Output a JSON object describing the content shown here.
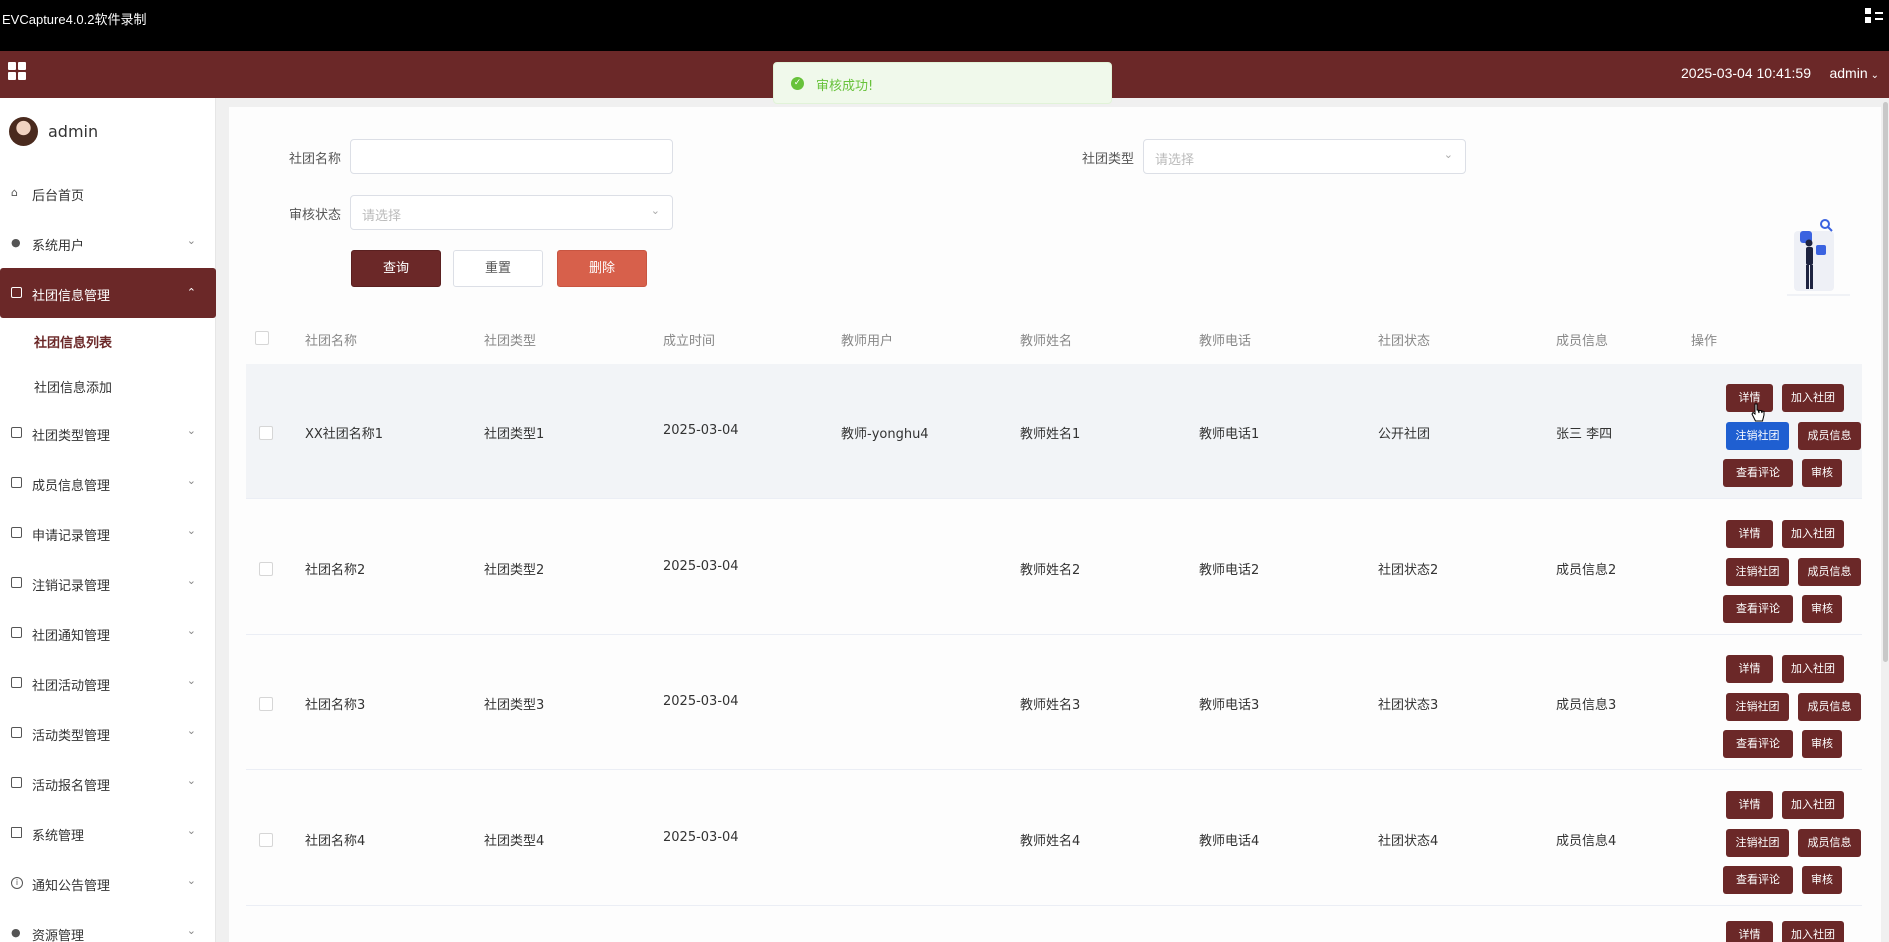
{
  "recorder": {
    "title": "EVCapture4.0.2软件录制"
  },
  "header": {
    "datetime": "2025-03-04 10:41:59",
    "user": "admin"
  },
  "toast": {
    "message": "审核成功!"
  },
  "sidebar": {
    "username": "admin",
    "items": [
      {
        "label": "后台首页",
        "icon": "home-icon"
      },
      {
        "label": "系统用户",
        "icon": "user-icon"
      },
      {
        "label": "社团信息管理",
        "icon": "box-icon",
        "active": true
      },
      {
        "label": "社团信息列表",
        "sub": true,
        "current": true
      },
      {
        "label": "社团信息添加",
        "sub": true
      },
      {
        "label": "社团类型管理",
        "icon": "box-icon"
      },
      {
        "label": "成员信息管理",
        "icon": "box-icon"
      },
      {
        "label": "申请记录管理",
        "icon": "box-icon"
      },
      {
        "label": "注销记录管理",
        "icon": "box-icon"
      },
      {
        "label": "社团通知管理",
        "icon": "box-icon"
      },
      {
        "label": "社团活动管理",
        "icon": "box-icon"
      },
      {
        "label": "活动类型管理",
        "icon": "box-icon"
      },
      {
        "label": "活动报名管理",
        "icon": "box-icon"
      },
      {
        "label": "系统管理",
        "icon": "image-icon"
      },
      {
        "label": "通知公告管理",
        "icon": "info-icon"
      },
      {
        "label": "资源管理",
        "icon": "pin-icon"
      }
    ]
  },
  "filters": {
    "name_label": "社团名称",
    "name_value": "",
    "type_label": "社团类型",
    "type_placeholder": "请选择",
    "status_label": "审核状态",
    "status_placeholder": "请选择"
  },
  "buttons": {
    "query": "查询",
    "reset": "重置",
    "delete": "删除"
  },
  "table": {
    "columns": [
      "社团名称",
      "社团类型",
      "成立时间",
      "教师用户",
      "教师姓名",
      "教师电话",
      "社团状态",
      "成员信息",
      "操作"
    ],
    "rows": [
      [
        "XX社团名称1",
        "社团类型1",
        "2025-03-04",
        "教师-yonghu4",
        "教师姓名1",
        "教师电话1",
        "公开社团",
        "张三 李四"
      ],
      [
        "社团名称2",
        "社团类型2",
        "2025-03-04",
        "",
        "教师姓名2",
        "教师电话2",
        "社团状态2",
        "成员信息2"
      ],
      [
        "社团名称3",
        "社团类型3",
        "2025-03-04",
        "",
        "教师姓名3",
        "教师电话3",
        "社团状态3",
        "成员信息3"
      ],
      [
        "社团名称4",
        "社团类型4",
        "2025-03-04",
        "",
        "教师姓名4",
        "教师电话4",
        "社团状态4",
        "成员信息4"
      ]
    ],
    "actions": {
      "detail": "详情",
      "join": "加入社团",
      "cancel": "注销社团",
      "members": "成员信息",
      "comments": "查看评论",
      "review": "审核"
    }
  },
  "colors": {
    "brand": "#6b2828",
    "danger": "#d7604b",
    "primary_blue": "#1f5fd1",
    "success": "#67c23a"
  }
}
